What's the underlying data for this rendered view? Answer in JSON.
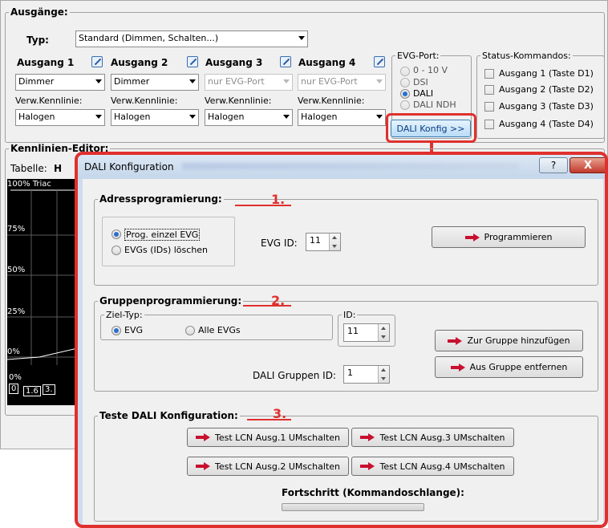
{
  "main": {
    "ausgaenge_legend": "Ausgänge:",
    "typ_label": "Typ:",
    "typ_value": "Standard (Dimmen, Schalten...)",
    "outputs": [
      {
        "title": "Ausgang 1",
        "mode": "Dimmer",
        "kennlinie_label": "Verw.Kennlinie:",
        "kennlinie": "Halogen"
      },
      {
        "title": "Ausgang 2",
        "mode": "Dimmer",
        "kennlinie_label": "Verw.Kennlinie:",
        "kennlinie": "Halogen"
      },
      {
        "title": "Ausgang 3",
        "mode": "nur EVG-Port",
        "kennlinie_label": "Verw.Kennlinie:",
        "kennlinie": "Halogen"
      },
      {
        "title": "Ausgang 4",
        "mode": "nur EVG-Port",
        "kennlinie_label": "Verw.Kennlinie:",
        "kennlinie": "Halogen"
      }
    ],
    "evg_port": {
      "legend": "EVG-Port:",
      "options": [
        "0 - 10 V",
        "DSI",
        "DALI",
        "DALI NDH"
      ],
      "selected": "DALI"
    },
    "dali_konfig_button": "DALI Konfig >>",
    "status": {
      "legend": "Status-Kommandos:",
      "items": [
        "Ausgang 1 (Taste D1)",
        "Ausgang 2 (Taste D2)",
        "Ausgang 3 (Taste D3)",
        "Ausgang 4 (Taste D4)"
      ]
    },
    "kennlinien_legend": "Kennlinien-Editor:",
    "tabelle_label": "Tabelle:",
    "tabelle_value": "H",
    "graph_labels": {
      "top": "100% Triac",
      "l75": "75%",
      "l50": "50%",
      "l25": "25%",
      "l0": "0%",
      "bottom": "0%",
      "x0": "0",
      "x1": "1.6",
      "x2": "3."
    }
  },
  "dialog": {
    "title": "DALI Konfiguration",
    "help": "?",
    "close": "X",
    "adress": {
      "legend": "Adressprogramierung:",
      "number": "1.",
      "opt1": "Prog. einzel EVG",
      "opt2": "EVGs (IDs) löschen",
      "evg_id_label": "EVG ID:",
      "evg_id_value": "11",
      "program_button": "Programmieren"
    },
    "gruppen": {
      "legend": "Gruppenprogrammierung:",
      "number": "2.",
      "ziel_legend": "Ziel-Typ:",
      "ziel_opt1": "EVG",
      "ziel_opt2": "Alle EVGs",
      "id_legend": "ID:",
      "id_value": "11",
      "gruppen_id_label": "DALI Gruppen ID:",
      "gruppen_id_value": "1",
      "add_button": "Zur Gruppe hinzufügen",
      "remove_button": "Aus Gruppe entfernen"
    },
    "teste": {
      "legend": "Teste DALI Konfiguration:",
      "number": "3.",
      "buttons": [
        "Test LCN Ausg.1 UMschalten",
        "Test LCN Ausg.3 UMschalten",
        "Test LCN Ausg.2 UMschalten",
        "Test LCN Ausg.4 UMschalten"
      ],
      "fortschritt_label": "Fortschritt (Kommandoschlange):",
      "progress": 0
    }
  },
  "colors": {
    "highlight": "#e0302e",
    "accent": "#2a6fd1"
  }
}
